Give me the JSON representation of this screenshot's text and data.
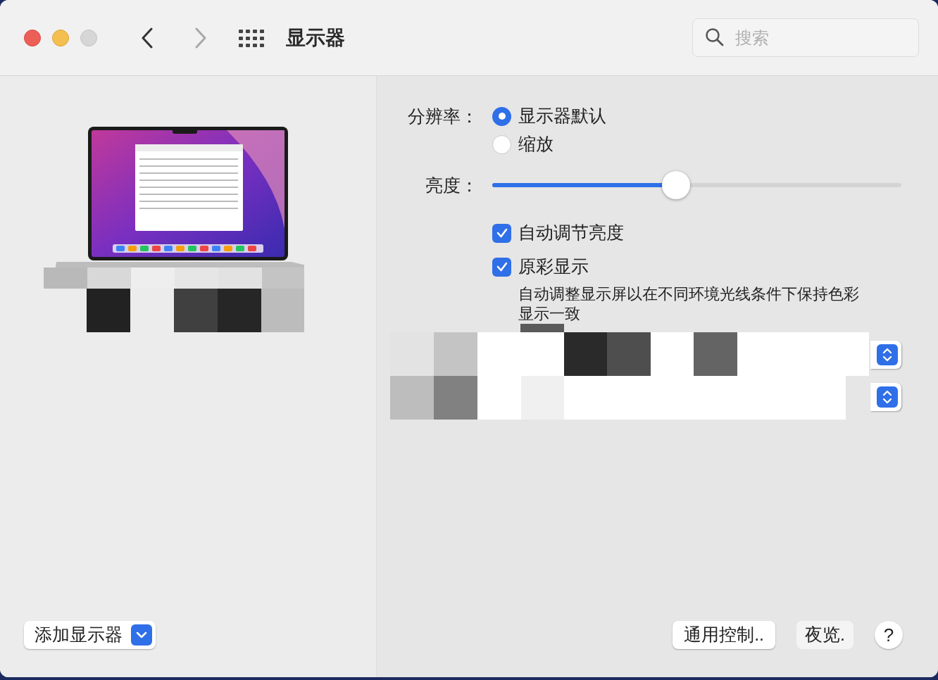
{
  "window": {
    "title": "显示器"
  },
  "search": {
    "placeholder": "搜索"
  },
  "resolution": {
    "label": "分辨率：",
    "options": [
      {
        "label": "显示器默认",
        "selected": true
      },
      {
        "label": "缩放",
        "selected": false
      }
    ]
  },
  "brightness": {
    "label": "亮度：",
    "level": 0.45
  },
  "checkboxes": [
    {
      "label": "自动调节亮度",
      "checked": true
    },
    {
      "label": "原彩显示",
      "checked": true,
      "description": "自动调整显示屏以在不同环境光线条件下保持色彩显示一致"
    }
  ],
  "add_display_button": "添加显示器",
  "bottom_buttons": [
    "通用控制..",
    "夜览."
  ],
  "help_button": "?"
}
